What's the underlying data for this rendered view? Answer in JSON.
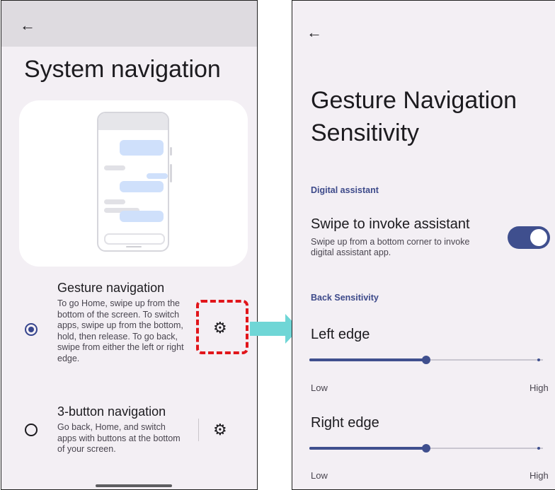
{
  "left_screen": {
    "back_glyph": "←",
    "title": "System navigation",
    "options": [
      {
        "title": "Gesture navigation",
        "description": "To go Home, swipe up from the bottom of the screen. To switch apps, swipe up from the bottom, hold, then release. To go back, swipe from either the left or right edge.",
        "selected": true,
        "settings_icon": "gear-icon"
      },
      {
        "title": "3-button navigation",
        "description": "Go back, Home, and switch apps with buttons at the bottom of your screen.",
        "selected": false,
        "settings_icon": "gear-icon"
      }
    ],
    "gear_glyph": "⚙"
  },
  "annotation": {
    "highlight_color": "#e1151a",
    "arrow_color": "#6fd6d6"
  },
  "right_screen": {
    "back_glyph": "←",
    "title": "Gesture Navigation Sensitivity",
    "digital_assistant_header": "Digital assistant",
    "swipe_assistant": {
      "title": "Swipe to invoke assistant",
      "description": "Swipe up from a bottom corner to invoke digital assistant app.",
      "enabled": true
    },
    "back_sensitivity_header": "Back Sensitivity",
    "left_edge": {
      "label": "Left edge",
      "value": 0.5,
      "low_label": "Low",
      "high_label": "High"
    },
    "right_edge": {
      "label": "Right edge",
      "value": 0.5,
      "low_label": "Low",
      "high_label": "High"
    }
  },
  "colors": {
    "accent": "#3f4f8e",
    "section_header": "#3d4a8a",
    "background": "#f3eff4"
  }
}
